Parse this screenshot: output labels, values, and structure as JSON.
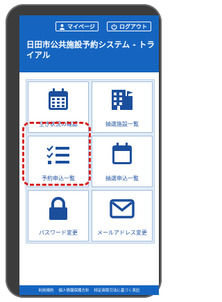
{
  "header": {
    "mypage_label": "マイページ",
    "logout_label": "ログアウト",
    "title": "日田市公共施設予約システム - トライアル"
  },
  "menu": {
    "tiles": [
      {
        "label": "空き状況の確認",
        "icon": "calendar-icon"
      },
      {
        "label": "抽選施設一覧",
        "icon": "building-icon"
      },
      {
        "label": "予約申込一覧",
        "icon": "checklist-icon"
      },
      {
        "label": "抽選申込一覧",
        "icon": "calendar-blank-icon"
      },
      {
        "label": "パスワード変更",
        "icon": "lock-icon"
      },
      {
        "label": "メールアドレス変更",
        "icon": "envelope-icon"
      }
    ]
  },
  "footer": {
    "links": [
      "利用規約",
      "個人情報保護方針",
      "特定商取引法に基づく表記"
    ]
  },
  "colors": {
    "primary": "#1565c0",
    "highlight": "#d81b1b",
    "frame": "#3c3c3c"
  }
}
